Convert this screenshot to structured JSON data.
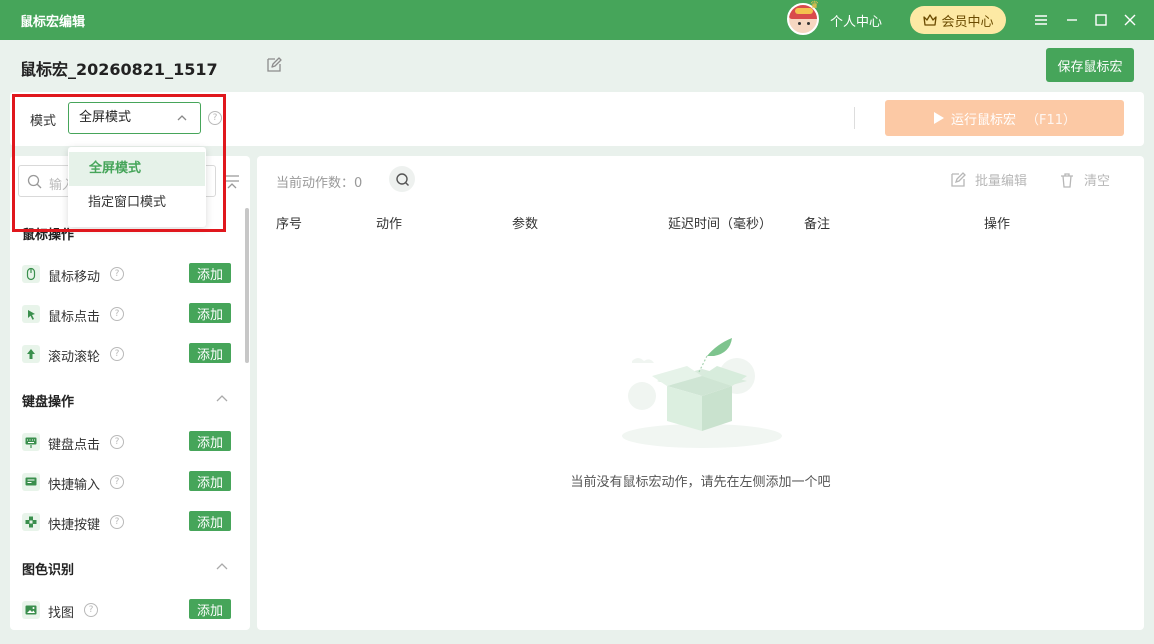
{
  "titlebar": {
    "app_title": "鼠标宏编辑",
    "personal_center": "个人中心",
    "vip_center": "会员中心",
    "controls": [
      "menu-icon",
      "minimize-icon",
      "maximize-icon",
      "close-icon"
    ]
  },
  "namebar": {
    "macro_name": "鼠标宏_20260821_1517",
    "save_label": "保存鼠标宏"
  },
  "modebar": {
    "mode_label": "模式",
    "mode_value": "全屏模式",
    "help": "?",
    "run_label": "运行鼠标宏",
    "run_shortcut": "（F11）"
  },
  "dropdown": {
    "options": [
      "全屏模式",
      "指定窗口模式"
    ],
    "selected_index": 0
  },
  "left": {
    "search_placeholder": "输入",
    "add_label": "添加",
    "categories": [
      {
        "title": "鼠标操作",
        "items": [
          "鼠标移动",
          "鼠标点击",
          "滚动滚轮"
        ]
      },
      {
        "title": "键盘操作",
        "items": [
          "键盘点击",
          "快捷输入",
          "快捷按键"
        ]
      },
      {
        "title": "图色识别",
        "items": [
          "找图"
        ]
      }
    ]
  },
  "right": {
    "count_label": "当前动作数：",
    "count_value": "0",
    "batch_edit": "批量编辑",
    "clear": "清空",
    "columns": [
      "序号",
      "动作",
      "参数",
      "延迟时间（毫秒）",
      "备注",
      "操作"
    ],
    "empty_text": "当前没有鼠标宏动作，请先在左侧添加一个吧"
  },
  "colors": {
    "primary": "#46a55a",
    "run_disabled": "#fcc9a5",
    "vip": "#fde9a4",
    "highlight": "#e0171d"
  }
}
